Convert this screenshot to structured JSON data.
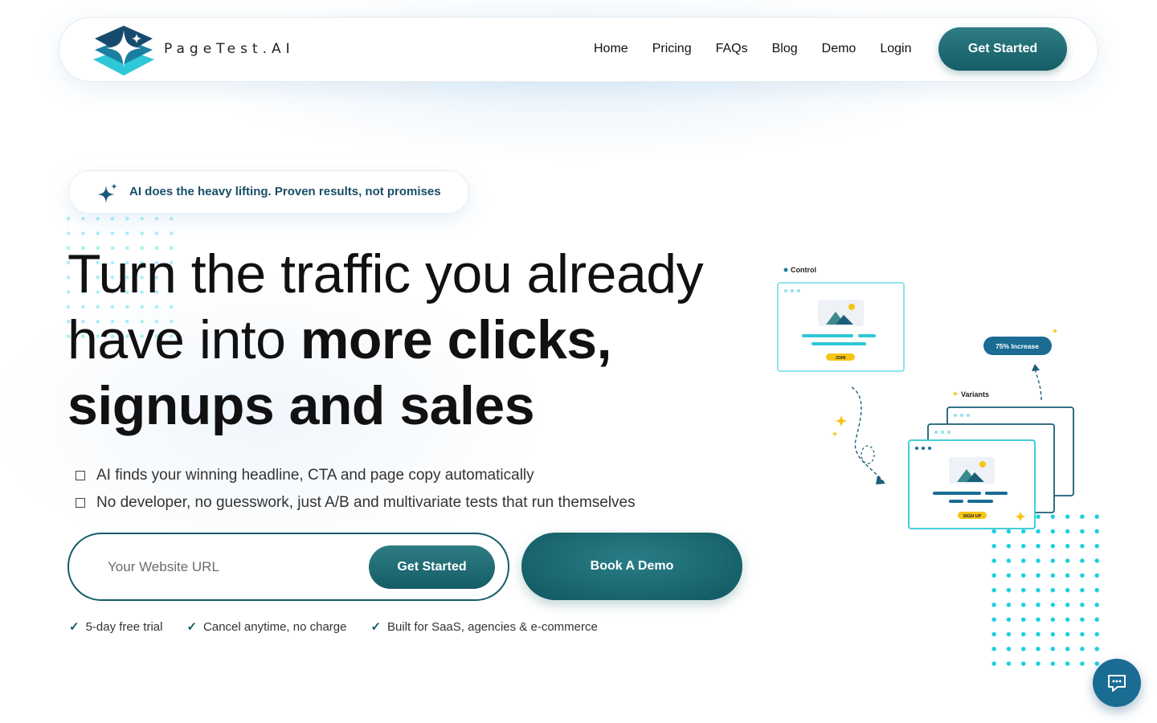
{
  "brand": {
    "name": "PageTest.AI"
  },
  "nav": {
    "links": [
      "Home",
      "Pricing",
      "FAQs",
      "Blog",
      "Demo",
      "Login"
    ],
    "cta": "Get Started"
  },
  "badge": {
    "text": "AI does the heavy lifting. Proven results, not promises"
  },
  "hero": {
    "line1": "Turn the traffic you already",
    "line2_regular": "have into ",
    "line2_bold": "more clicks,",
    "line3_bold": "signups and sales"
  },
  "bullets": [
    "AI finds your winning headline, CTA and page copy automatically",
    "No developer, no guesswork, just A/B and multivariate tests that run themselves"
  ],
  "url_form": {
    "placeholder": "Your Website URL",
    "button": "Get Started"
  },
  "demo_button": "Book A Demo",
  "checks": [
    "5-day free trial",
    "Cancel anytime, no charge",
    "Built for SaaS, agencies & e-commerce"
  ],
  "illustration": {
    "control_label": "Control",
    "control_button": "JOIN",
    "variants_label": "Variants",
    "variant_button": "SIGN UP",
    "increase_badge": "75% Increase"
  },
  "colors": {
    "primary": "#155d66",
    "accent_cyan": "#19d0dc",
    "chat": "#1a6c93",
    "star_yellow": "#f5c518"
  },
  "icons": [
    "sparkle-icon",
    "check-icon",
    "chat-icon",
    "logo-icon"
  ]
}
